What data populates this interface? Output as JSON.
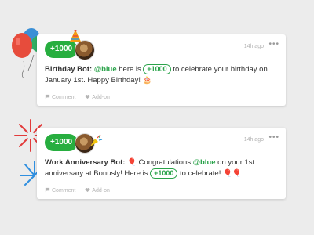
{
  "posts": [
    {
      "points_label": "+1000",
      "timestamp": "14h ago",
      "more_label": "•••",
      "bot_name": "Birthday Bot:",
      "mention": "@blue",
      "text_a": " here is ",
      "amount": "+1000",
      "text_b": " to celebrate your birthday on January 1st. Happy Birthday! ",
      "emoji": "🎂",
      "actions": {
        "comment": "Comment",
        "addon": "Add-on"
      }
    },
    {
      "points_label": "+1000",
      "timestamp": "14h ago",
      "more_label": "•••",
      "bot_name": "Work Anniversary Bot:",
      "emoji_a": "🎈",
      "text_a": " Congratulations ",
      "mention": "@blue",
      "text_b": " on your 1st anniversary at Bonusly! Here is ",
      "amount": "+1000",
      "text_c": " to celebrate! ",
      "emoji_b": "🎈🎈",
      "actions": {
        "comment": "Comment",
        "addon": "Add-on"
      }
    }
  ],
  "colors": {
    "accent": "#27ae3f",
    "background": "#ececec",
    "card": "#ffffff",
    "muted": "#b5b5b5"
  }
}
